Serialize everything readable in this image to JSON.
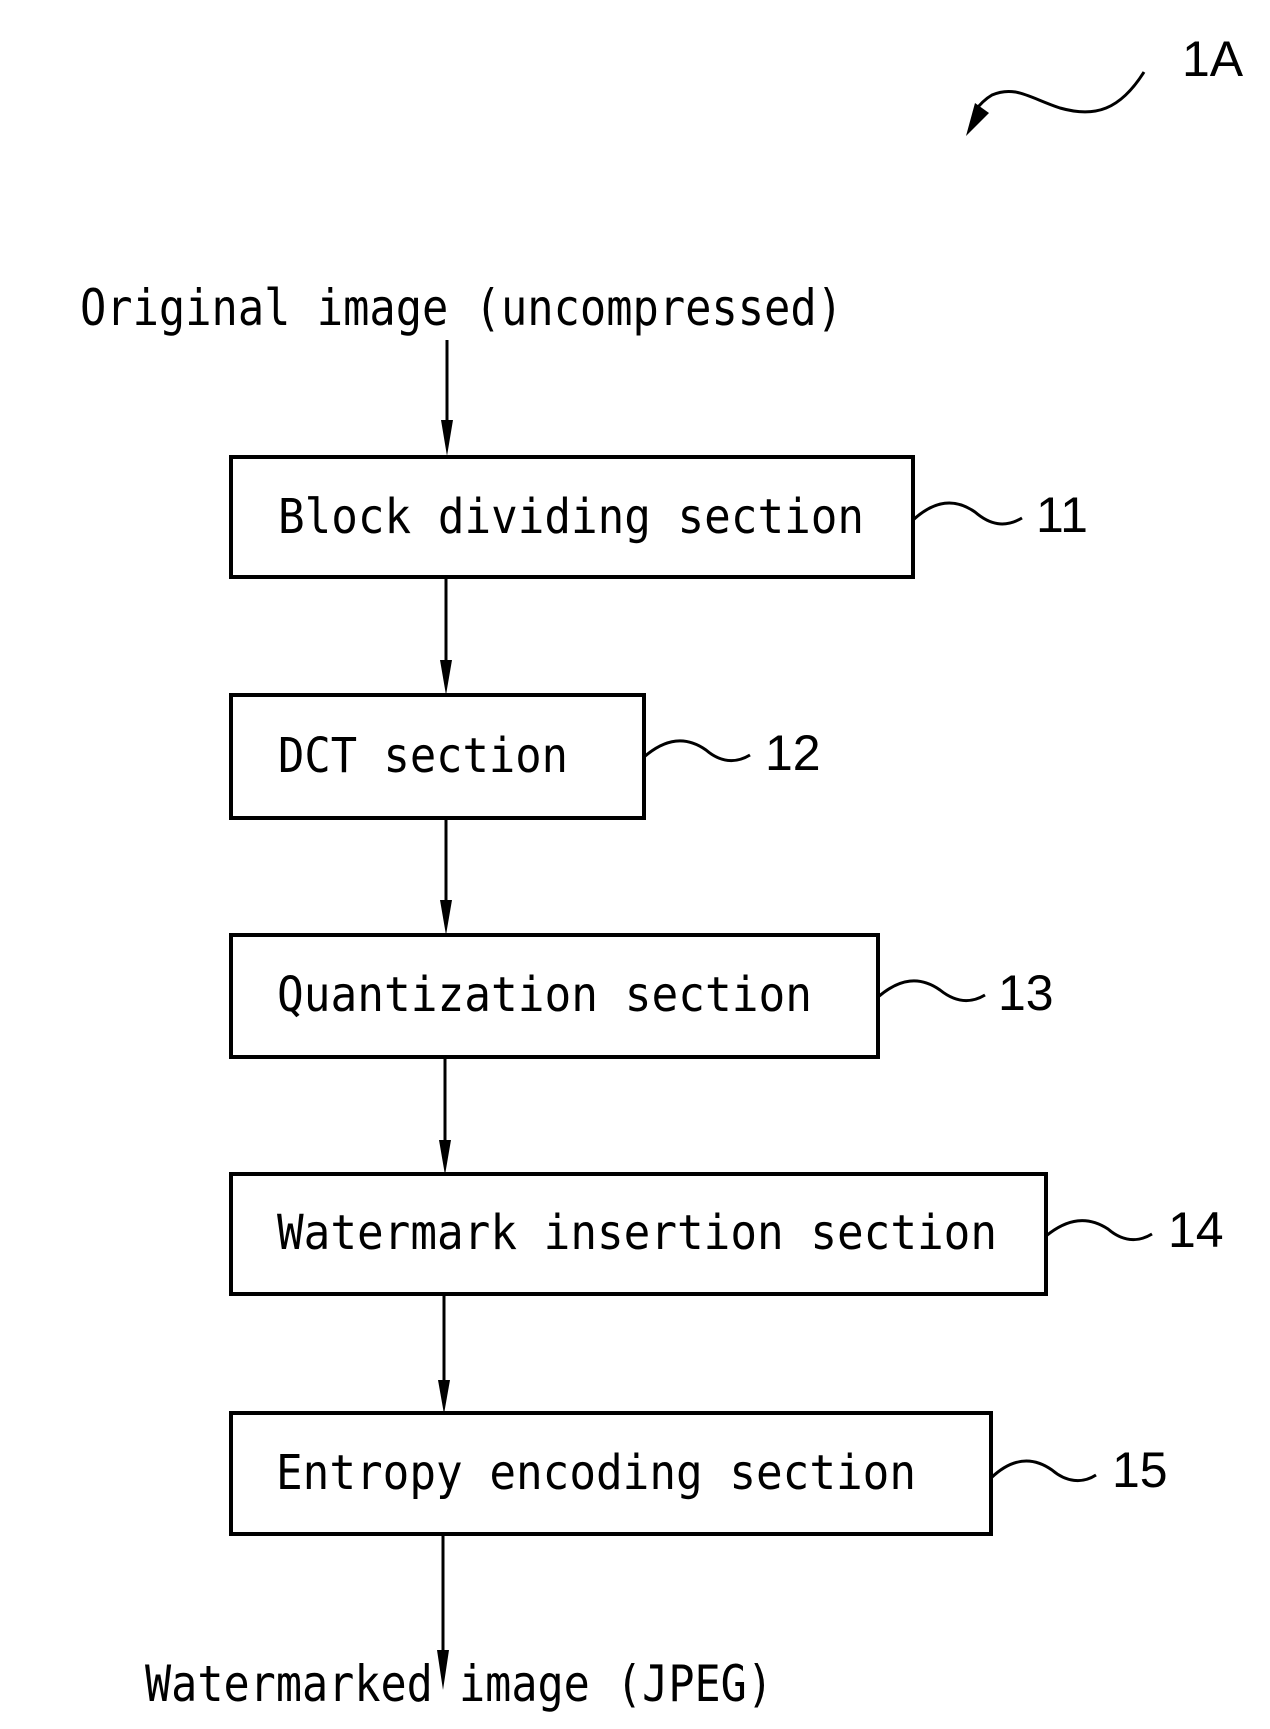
{
  "figure": {
    "id_label": "1A",
    "input_label": "Original image (uncompressed)",
    "output_label": "Watermarked image (JPEG)",
    "line_color": "#000000",
    "background": "#ffffff"
  },
  "blocks": [
    {
      "label": "Block dividing section",
      "ref": "11"
    },
    {
      "label": "DCT section",
      "ref": "12"
    },
    {
      "label": "Quantization section",
      "ref": "13"
    },
    {
      "label": "Watermark insertion section",
      "ref": "14"
    },
    {
      "label": "Entropy encoding section",
      "ref": "15"
    }
  ],
  "flow": [
    "input",
    "block-dividing",
    "dct",
    "quantization",
    "watermark-insertion",
    "entropy-encoding",
    "output"
  ]
}
